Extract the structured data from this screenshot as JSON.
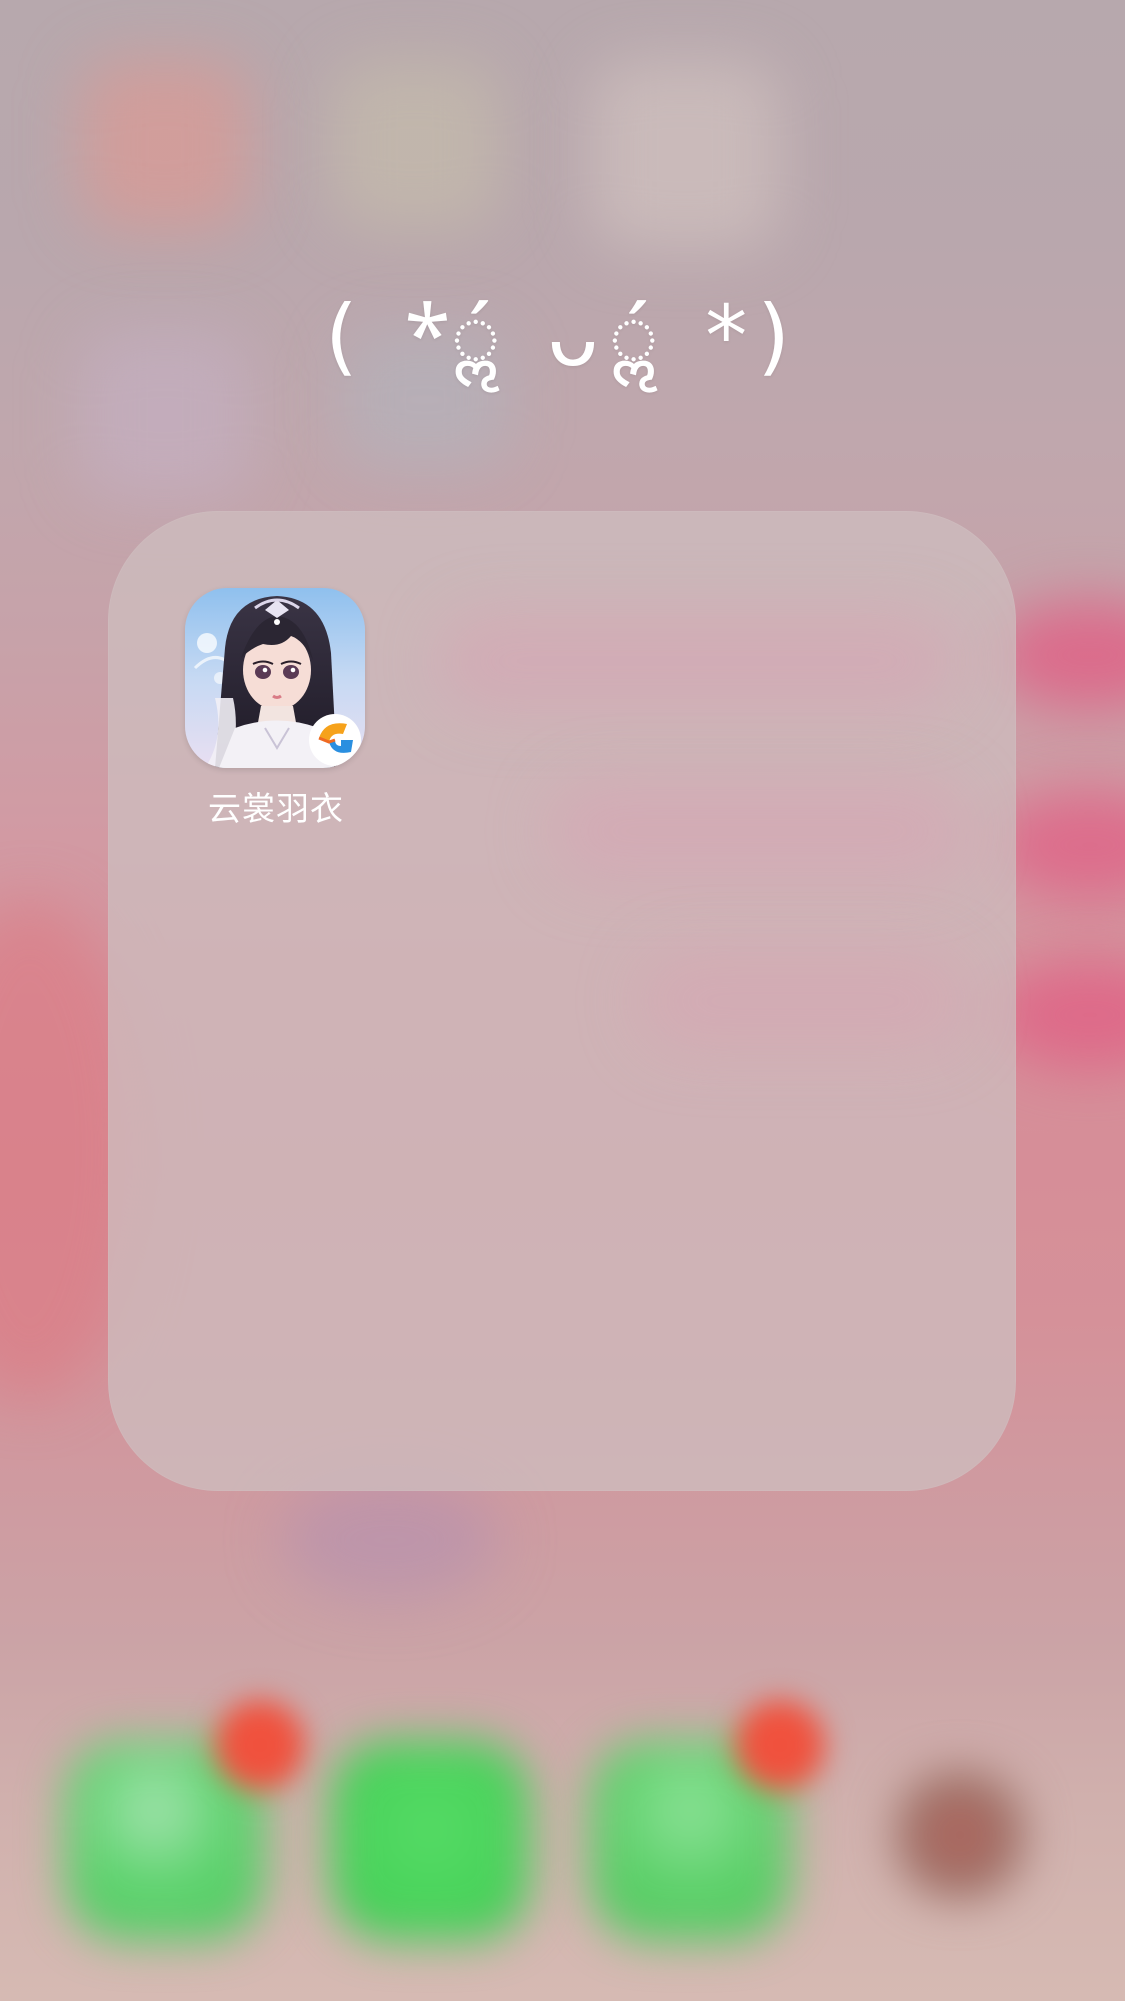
{
  "folder": {
    "title": "( *ॢ́ ᴗॢ́ *)"
  },
  "apps": [
    {
      "label": "云裳羽衣",
      "icon": "yunshang-yuyi-app-icon"
    }
  ],
  "colors": {
    "folder_panel": "#cdbcbe",
    "label_text": "#ffffff",
    "dock_green": "#4cd964",
    "badge_red": "#f0513d"
  }
}
